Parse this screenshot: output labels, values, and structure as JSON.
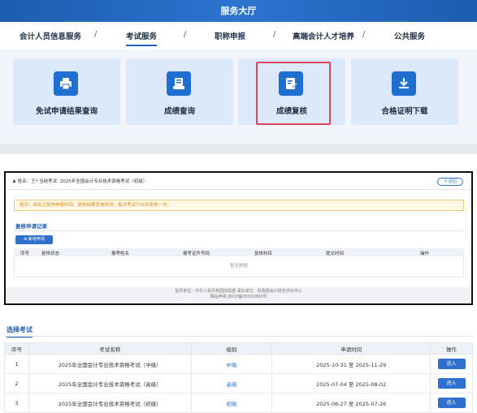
{
  "hall": {
    "title": "服务大厅",
    "nav": [
      {
        "label": "会计人员信息服务"
      },
      {
        "label": "考试服务"
      },
      {
        "label": "职称申报"
      },
      {
        "label": "高端会计人才培养"
      },
      {
        "label": "公共服务"
      }
    ],
    "separator": "/",
    "cards": [
      {
        "label": "免试申请结果查询",
        "icon": "printer-icon"
      },
      {
        "label": "成绩查询",
        "icon": "scores-icon"
      },
      {
        "label": "成绩复核",
        "icon": "review-edit-icon"
      },
      {
        "label": "合格证明下载",
        "icon": "download-icon"
      }
    ]
  },
  "review": {
    "user_line": "姓名：王*  当前考试: 2025年全国会计专业技术资格考试（初级）",
    "back_label": "返回",
    "tip": "提示：请关注复核申报时间、复核结果查询时间；每次考试只允许复核一次。",
    "records_title": "复核申请记录",
    "new_button": "新增申请",
    "columns": [
      "序号",
      "复核状态",
      "报考姓名",
      "报考证件号码",
      "复核科目",
      "提交时间",
      "操作"
    ],
    "empty": "暂无数据",
    "footer_line1": "指导单位：中华人民共和国财政部    承办单位：财政部会计财务评价中心",
    "footer_line2": "网站声明    京ICP备05002860号"
  },
  "select": {
    "title": "选择考试",
    "columns": [
      "序号",
      "考试名称",
      "级别",
      "申请时间",
      "操作"
    ],
    "rows": [
      {
        "no": "1",
        "name": "2025年全国会计专业技术资格考试（中级）",
        "level": "中级",
        "time": "2025-10-31 至 2025-11-29",
        "action": "进入"
      },
      {
        "no": "2",
        "name": "2025年全国会计专业技术资格考试（高级）",
        "level": "高级",
        "time": "2025-07-04 至 2025-08-02",
        "action": "进入"
      },
      {
        "no": "3",
        "name": "2025年全国会计专业技术资格考试（初级）",
        "level": "初级",
        "time": "2025-06-27 至 2025-07-26",
        "action": "进入"
      }
    ]
  },
  "colors": {
    "primary": "#2f6fcf",
    "highlight": "#e0445a",
    "tip": "#d88a1b"
  }
}
